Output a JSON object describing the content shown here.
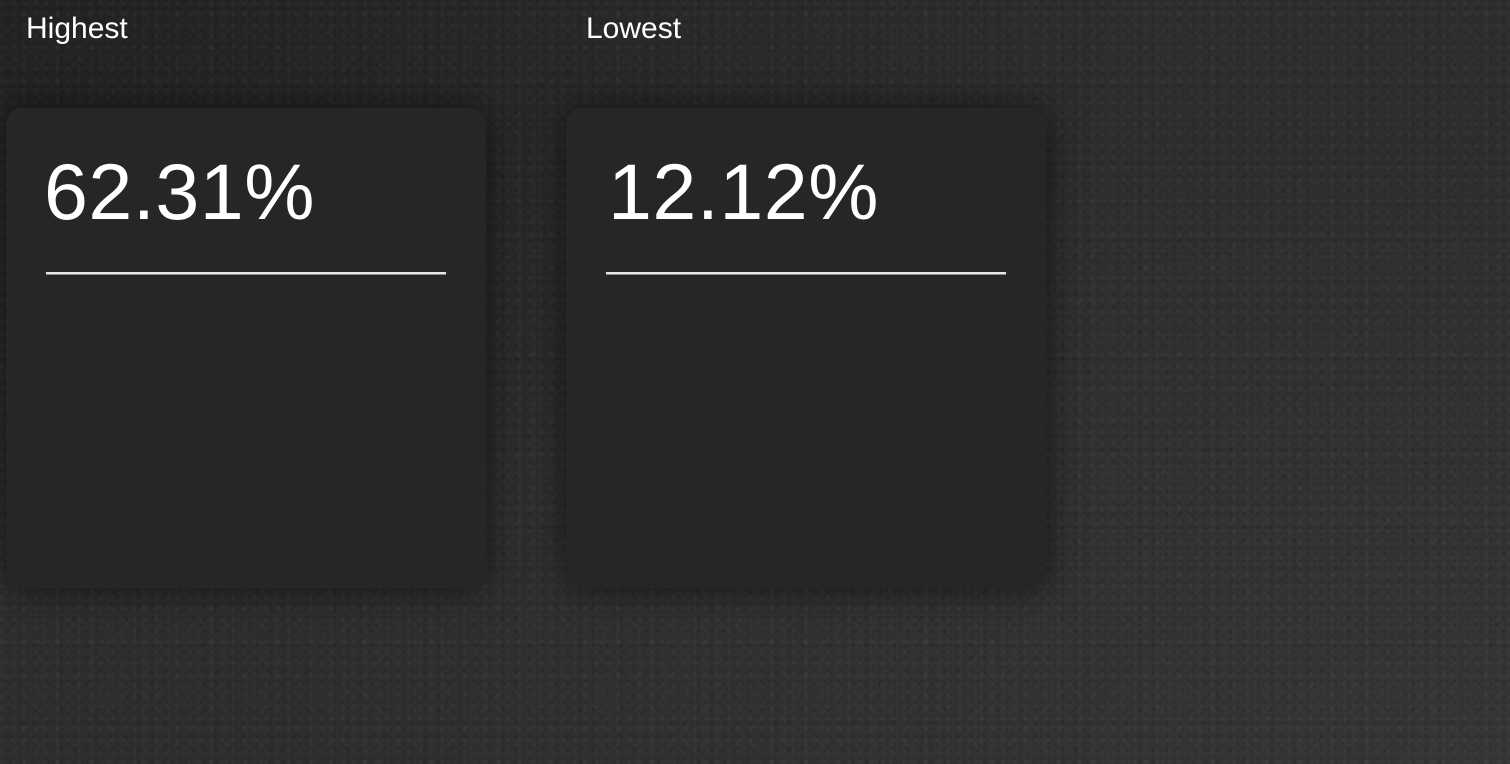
{
  "panels": [
    {
      "label": "Highest",
      "value": "62.31%"
    },
    {
      "label": "Lowest",
      "value": "12.12%"
    }
  ],
  "colors": {
    "background": "#2e2e2e",
    "card": "#262626",
    "text": "#ffffff",
    "divider": "#e6e6e6"
  }
}
